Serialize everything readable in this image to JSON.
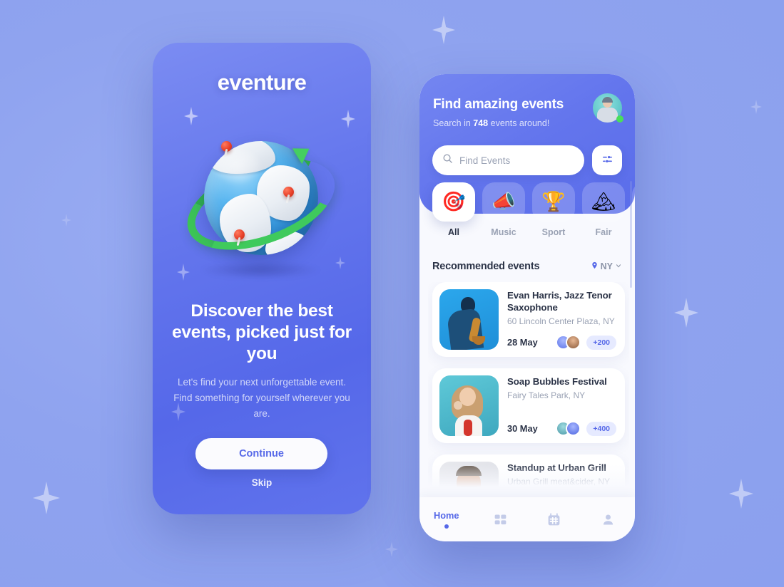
{
  "theme": {
    "page_bg": "#93a6f0",
    "brand_blue": "#5668e8",
    "onboard_gradient_from": "#7b8cf2",
    "onboard_gradient_to": "#5568e9",
    "card_bg": "#ffffff",
    "app_bg": "#f8f9fe",
    "muted_text": "#9aa2b4",
    "dark_text": "#2b3347",
    "online_green": "#4ade5b"
  },
  "onboarding": {
    "brand": "eventure",
    "illustration_name": "globe-with-location-pins",
    "headline": "Discover the best events, picked just for you",
    "subtext": "Let's find your next unforgettable event. Find something for yourself wherever you are.",
    "continue_label": "Continue",
    "skip_label": "Skip"
  },
  "app": {
    "header": {
      "title": "Find amazing events",
      "subtitle_prefix": "Search in ",
      "subtitle_count": "748",
      "subtitle_suffix": " events around!",
      "avatar_name": "user-avatar",
      "status": "online"
    },
    "search": {
      "placeholder": "Find Events",
      "value": "",
      "search_icon": "search-icon",
      "mic_icon": "microphone-icon",
      "filter_icon": "filter-sliders-icon"
    },
    "categories": [
      {
        "label": "All",
        "icon": "🎯",
        "icon_name": "target-icon",
        "active": true
      },
      {
        "label": "Music",
        "icon": "📣",
        "icon_name": "megaphone-icon",
        "active": false
      },
      {
        "label": "Sport",
        "icon": "🏆",
        "icon_name": "trophy-icon",
        "active": false
      },
      {
        "label": "Fair",
        "icon": "🏔",
        "icon_name": "mountain-icon",
        "active": false
      }
    ],
    "recommended": {
      "title": "Recommended events",
      "location": "NY",
      "location_icon": "map-pin-icon",
      "chevron_icon": "chevron-down-icon"
    },
    "events": [
      {
        "title": "Evan Harris, Jazz Tenor Saxophone",
        "place": "60 Lincoln Center Plaza, NY",
        "date": "28 May",
        "attendees": "+200",
        "thumb_name": "saxophonist-photo"
      },
      {
        "title": "Soap Bubbles Festival",
        "place": "Fairy Tales Park, NY",
        "date": "30 May",
        "attendees": "+400",
        "thumb_name": "woman-blowing-bubbles-photo"
      },
      {
        "title": "Standup at Urban Grill",
        "place": "Urban Grill meat&cider, NY",
        "date": "",
        "attendees": "",
        "thumb_name": "comedian-portrait-photo"
      }
    ],
    "bottom_nav": [
      {
        "label": "Home",
        "icon_name": "home-tab",
        "active": true
      },
      {
        "label": "",
        "icon_name": "grid-icon",
        "active": false
      },
      {
        "label": "",
        "icon_name": "calendar-icon",
        "active": false
      },
      {
        "label": "",
        "icon_name": "person-icon",
        "active": false
      }
    ]
  }
}
